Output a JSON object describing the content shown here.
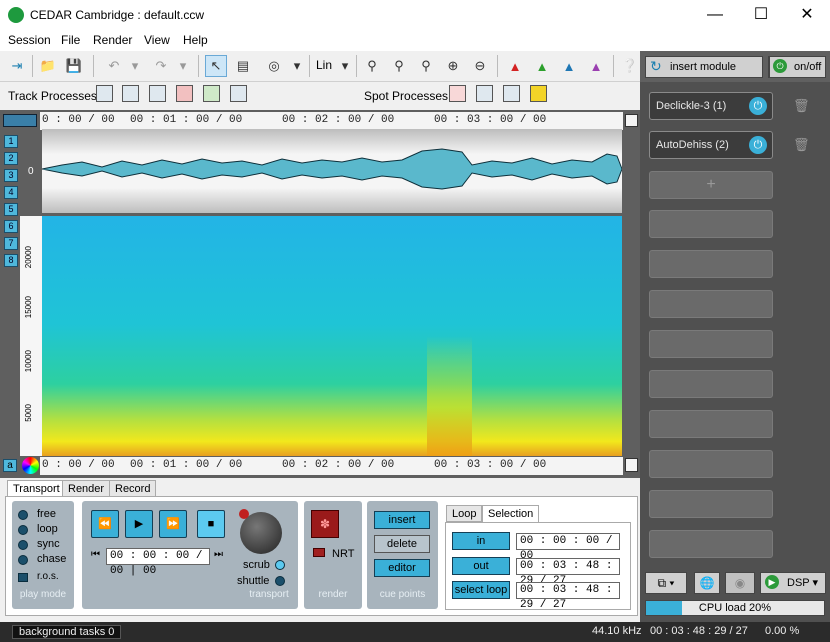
{
  "window": {
    "title": "CEDAR Cambridge : default.ccw"
  },
  "menu": [
    "Session",
    "File",
    "Render",
    "View",
    "Help"
  ],
  "toolbar": {
    "scale": "Lin",
    "insert_module": "insert module",
    "on_off": "on/off"
  },
  "labels": {
    "track_processes": "Track Processes",
    "spot_processes": "Spot Processes"
  },
  "channels": [
    "1",
    "2",
    "3",
    "4",
    "5",
    "6",
    "7",
    "8"
  ],
  "channel_extra": "a",
  "timeline": {
    "ticks": [
      "0 : 00 / 00",
      "00 : 01 : 00 / 00",
      "00 : 02 : 00 / 00",
      "00 : 03 : 00 / 00"
    ],
    "zero_label": "0"
  },
  "spectrogram": {
    "y_ticks": [
      "20000",
      "15000",
      "10000",
      "5000"
    ]
  },
  "modules": [
    {
      "name": "Declickle-3 (1)"
    },
    {
      "name": "AutoDehiss (2)"
    }
  ],
  "tabs": {
    "bottom": [
      "Transport",
      "Render",
      "Record"
    ],
    "selection": [
      "Loop",
      "Selection"
    ]
  },
  "play_mode": {
    "options": [
      "free",
      "loop",
      "sync",
      "chase"
    ],
    "ros": "r.o.s.",
    "label": "play mode"
  },
  "transport": {
    "timecode": "00 : 00 : 00 / 00 | 00",
    "scrub": "scrub",
    "shuttle": "shuttle",
    "label": "transport"
  },
  "render": {
    "nrt": "NRT",
    "label": "render"
  },
  "cue_points": {
    "insert": "insert",
    "delete": "delete",
    "editor": "editor",
    "label": "cue points"
  },
  "selection": {
    "in": "in",
    "out": "out",
    "select_loop": "select loop",
    "in_time": "00 : 00 : 00 / 00",
    "out_time": "00 : 03 : 48 : 29 / 27",
    "loop_time": "00 : 03 : 48 : 29 / 27"
  },
  "right_bottom": {
    "dsp": "DSP",
    "cpu_load": "CPU load 20%",
    "cpu_fraction": 0.2
  },
  "status": {
    "background_tasks": "background tasks 0",
    "sample_rate": "44.10 kHz",
    "duration": "00 : 03 : 48 : 29 / 27",
    "percent": "0.00 %"
  }
}
